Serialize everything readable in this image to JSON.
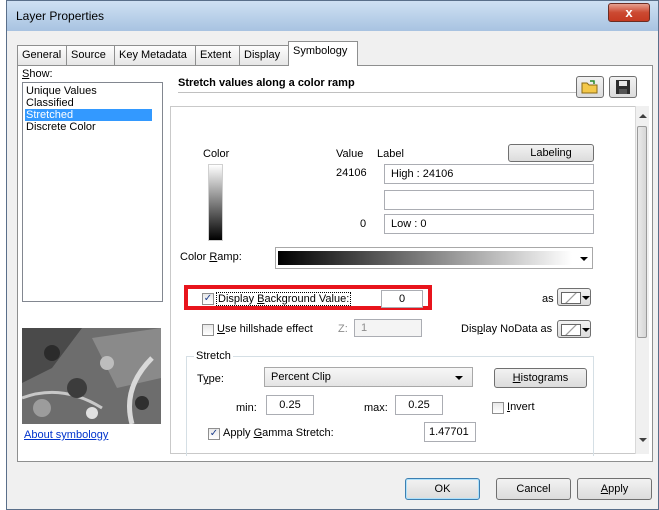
{
  "window": {
    "title": "Layer Properties",
    "close_glyph": "x"
  },
  "tabs": [
    {
      "label": "General"
    },
    {
      "label": "Source"
    },
    {
      "label": "Key Metadata"
    },
    {
      "label": "Extent"
    },
    {
      "label": "Display"
    },
    {
      "label": "Symbology",
      "active": true
    }
  ],
  "show": {
    "label": "Show:",
    "items": [
      "Unique Values",
      "Classified",
      "Stretched",
      "Discrete Color"
    ],
    "selected": "Stretched"
  },
  "about_link": "About symbology",
  "header": {
    "title": "Stretch values along a color ramp"
  },
  "icons": {
    "open": "folder-open-icon",
    "save": "save-icon"
  },
  "legend": {
    "col_color": "Color",
    "col_value": "Value",
    "col_label": "Label",
    "labeling_button": "Labeling",
    "high_value": "24106",
    "high_label": "High : 24106",
    "mid_label": "",
    "low_value": "0",
    "low_label": "Low : 0"
  },
  "color_ramp": {
    "label": "Color Ramp:"
  },
  "background": {
    "checkbox_label": "Display Background Value:",
    "checked": true,
    "value": "0",
    "as_label": "as",
    "highlight_color": "#e8141c"
  },
  "hillshade": {
    "checkbox_label": "Use hillshade effect",
    "checked": false,
    "z_label": "Z:",
    "z_value": "1",
    "nodata_label": "Display NoData as"
  },
  "stretch": {
    "group_label": "Stretch",
    "type_label": "Type:",
    "type_value": "Percent Clip",
    "histograms_button": "Histograms",
    "min_label": "min:",
    "min_value": "0.25",
    "max_label": "max:",
    "max_value": "0.25",
    "invert_label": "Invert",
    "invert_checked": false,
    "gamma_label": "Apply Gamma Stretch:",
    "gamma_checked": true,
    "gamma_value": "1.47701"
  },
  "footer": {
    "ok": "OK",
    "cancel": "Cancel",
    "apply": "Apply"
  }
}
